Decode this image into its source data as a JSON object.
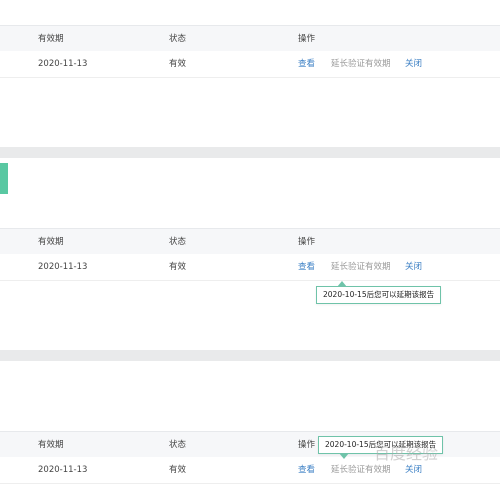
{
  "tables": [
    {
      "header": {
        "expiry": "有效期",
        "status": "状态",
        "ops": "操作"
      },
      "row": {
        "expiry": "2020-11-13",
        "status": "有效",
        "view": "查看",
        "extend": "延长验证有效期",
        "close": "关闭"
      }
    },
    {
      "header": {
        "expiry": "有效期",
        "status": "状态",
        "ops": "操作"
      },
      "row": {
        "expiry": "2020-11-13",
        "status": "有效",
        "view": "查看",
        "extend": "延长验证有效期",
        "close": "关闭"
      },
      "tooltip": "2020-10-15后您可以延期该报告"
    },
    {
      "header": {
        "expiry": "有效期",
        "status": "状态",
        "ops": "操作"
      },
      "row": {
        "expiry": "2020-11-13",
        "status": "有效",
        "view": "查看",
        "extend": "延长验证有效期",
        "close": "关闭"
      },
      "tooltip": "2020-10-15后您可以延期该报告"
    }
  ],
  "watermark": "百度经验",
  "colors": {
    "accent": "#59c8a2",
    "link": "#3b7fc4",
    "muted": "#9a9a9a"
  }
}
